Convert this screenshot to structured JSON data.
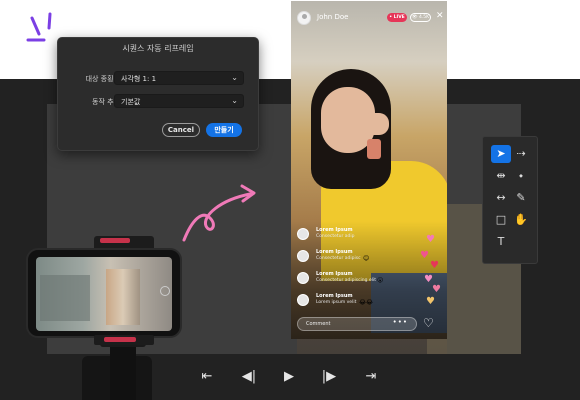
{
  "dialog": {
    "title": "시퀀스 자동 리프레임",
    "aspect_label": "대상 종횡비",
    "aspect_value": "사각형 1: 1",
    "motion_label": "동작 추적",
    "motion_value": "기본값",
    "cancel_label": "Cancel",
    "confirm_label": "만들기"
  },
  "live": {
    "user_name": "John Doe",
    "live_badge": "• LIVE",
    "view_badge": "👁 4.5K",
    "comments": [
      {
        "name": "Lorem Ipsum",
        "text": "Consectetur adip",
        "emoji": ""
      },
      {
        "name": "Lorem Ipsum",
        "text": "Consectetur adipisc",
        "emoji": "😊"
      },
      {
        "name": "Lorem Ipsum",
        "text": "Consectetur adipiscing elit",
        "emoji": "😮"
      },
      {
        "name": "Lorem Ipsum",
        "text": "Lorem ipsum velit",
        "emoji": "😂😂"
      }
    ],
    "comment_placeholder": "Comment",
    "comment_dots": "•••"
  },
  "tools": [
    {
      "name": "selection-tool-icon",
      "glyph": "➤",
      "active": true
    },
    {
      "name": "track-select-tool-icon",
      "glyph": "⇢",
      "active": false
    },
    {
      "name": "ripple-edit-tool-icon",
      "glyph": "⇹",
      "active": false
    },
    {
      "name": "razor-tool-icon",
      "glyph": "⬩",
      "active": false
    },
    {
      "name": "slip-tool-icon",
      "glyph": "↔",
      "active": false
    },
    {
      "name": "pen-tool-icon",
      "glyph": "✎",
      "active": false
    },
    {
      "name": "rectangle-tool-icon",
      "glyph": "□",
      "active": false
    },
    {
      "name": "hand-tool-icon",
      "glyph": "✋",
      "active": false
    },
    {
      "name": "type-tool-icon",
      "glyph": "T",
      "active": false
    }
  ],
  "transport": {
    "go_to_in": "⇤",
    "step_back": "◀|",
    "play": "▶",
    "step_forward": "|▶",
    "go_to_out": "⇥"
  },
  "colors": {
    "accent": "#1473e6",
    "live_red": "#e63658",
    "arrow_pink": "#f07ab8",
    "sparkle_purple": "#7b3fe4"
  }
}
